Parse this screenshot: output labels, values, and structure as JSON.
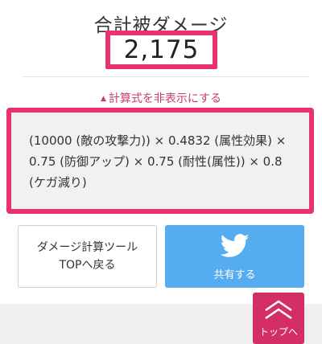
{
  "header": {
    "title": "合計被ダメージ",
    "damage_value": "2,175"
  },
  "toggle": {
    "arrow": "▲",
    "label": "計算式を非表示にする"
  },
  "formula": {
    "text": "(10000 (敵の攻撃力)) × 0.4832 (属性効果) × 0.75 (防御アップ) × 0.75 (耐性(属性)) × 0.8 (ケガ減り)"
  },
  "buttons": {
    "tool_line1": "ダメージ計算ツール",
    "tool_line2": "TOPへ戻る",
    "share_label": "共有する",
    "share_icon": "twitter-bird-icon"
  },
  "to_top": {
    "label": "トップへ",
    "icon": "double-chevron-up-icon"
  },
  "colors": {
    "accent": "#e9336f",
    "link": "#c83a6e",
    "twitter": "#55acee",
    "to_top_bg": "#d42e68",
    "formula_bg": "#f1f1f1"
  }
}
